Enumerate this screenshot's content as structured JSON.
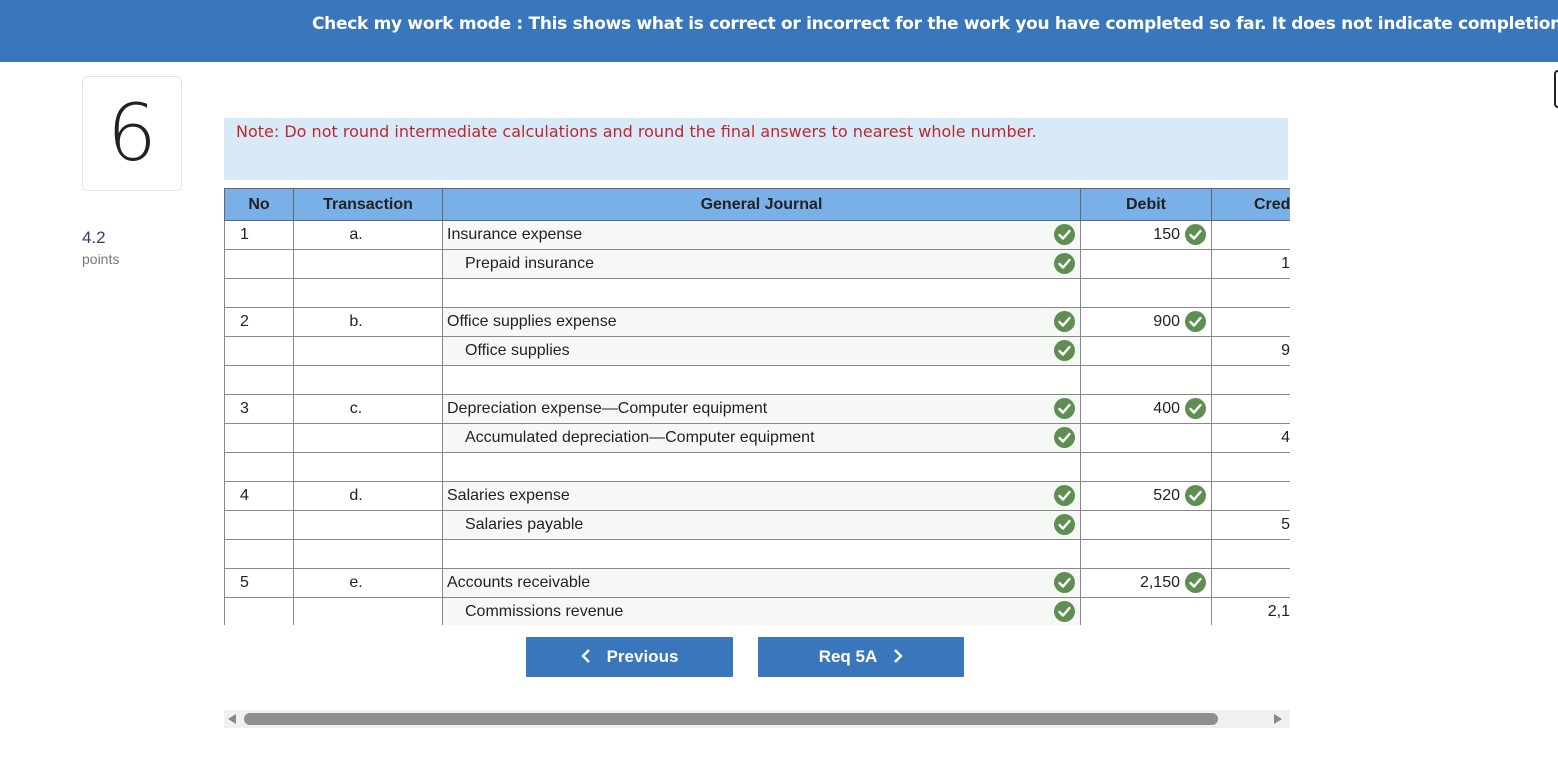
{
  "banner": {
    "text": "Check my work mode : This shows what is correct or incorrect for the work you have completed so far. It does not indicate completion."
  },
  "question": {
    "number": "6",
    "points_value": "4.2",
    "points_label": "points"
  },
  "note": "Note: Do not round intermediate calculations and round the final answers to nearest whole number.",
  "table": {
    "headers": {
      "no": "No",
      "transaction": "Transaction",
      "journal": "General Journal",
      "debit": "Debit",
      "credit": "Cred"
    },
    "rows": [
      {
        "no": "1",
        "tx": "a.",
        "account": "Insurance expense",
        "indent": false,
        "check": true,
        "debit": "150",
        "credit": ""
      },
      {
        "no": "",
        "tx": "",
        "account": "Prepaid insurance",
        "indent": true,
        "check": true,
        "debit": "",
        "credit": "1"
      },
      {
        "no": "",
        "tx": "",
        "account": "",
        "indent": false,
        "check": false,
        "debit": "",
        "credit": ""
      },
      {
        "no": "2",
        "tx": "b.",
        "account": "Office supplies expense",
        "indent": false,
        "check": true,
        "debit": "900",
        "credit": ""
      },
      {
        "no": "",
        "tx": "",
        "account": "Office supplies",
        "indent": true,
        "check": true,
        "debit": "",
        "credit": "9"
      },
      {
        "no": "",
        "tx": "",
        "account": "",
        "indent": false,
        "check": false,
        "debit": "",
        "credit": ""
      },
      {
        "no": "3",
        "tx": "c.",
        "account": "Depreciation expense—Computer equipment",
        "indent": false,
        "check": true,
        "debit": "400",
        "credit": ""
      },
      {
        "no": "",
        "tx": "",
        "account": "Accumulated depreciation—Computer equipment",
        "indent": true,
        "check": true,
        "debit": "",
        "credit": "4"
      },
      {
        "no": "",
        "tx": "",
        "account": "",
        "indent": false,
        "check": false,
        "debit": "",
        "credit": ""
      },
      {
        "no": "4",
        "tx": "d.",
        "account": "Salaries expense",
        "indent": false,
        "check": true,
        "debit": "520",
        "credit": ""
      },
      {
        "no": "",
        "tx": "",
        "account": "Salaries payable",
        "indent": true,
        "check": true,
        "debit": "",
        "credit": "5"
      },
      {
        "no": "",
        "tx": "",
        "account": "",
        "indent": false,
        "check": false,
        "debit": "",
        "credit": ""
      },
      {
        "no": "5",
        "tx": "e.",
        "account": "Accounts receivable",
        "indent": false,
        "check": true,
        "debit": "2,150",
        "credit": ""
      },
      {
        "no": "",
        "tx": "",
        "account": "Commissions revenue",
        "indent": true,
        "check": true,
        "debit": "",
        "credit": "2,1"
      }
    ]
  },
  "nav": {
    "prev_label": "Previous",
    "next_label": "Req 5A"
  },
  "colors": {
    "banner": "#3a76bb",
    "header": "#7ab0e8",
    "check": "#5f8e52",
    "note_text": "#c0262d",
    "note_bg": "#d8eaf8"
  },
  "icons": {
    "check": "check-circle-icon",
    "prev": "chevron-left-icon",
    "next": "chevron-right-icon"
  }
}
